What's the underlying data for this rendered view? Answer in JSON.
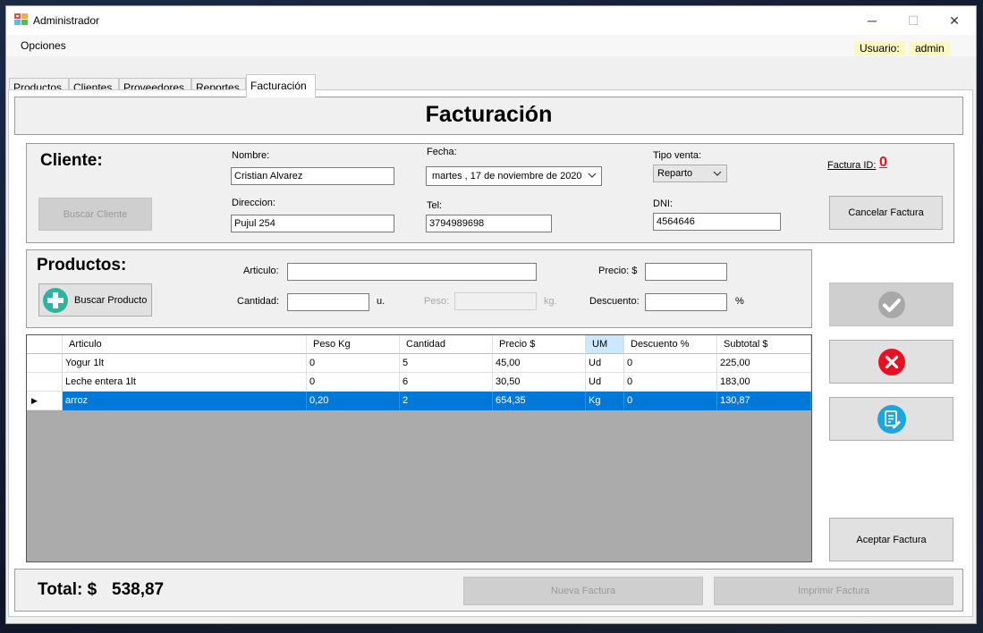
{
  "window": {
    "title": "Administrador",
    "minimize": "─",
    "maximize": "☐",
    "close": "✕"
  },
  "menu": {
    "opciones": "Opciones",
    "usuario_label": "Usuario:",
    "usuario_value": "admin"
  },
  "tabs": [
    {
      "label": "Productos"
    },
    {
      "label": "Clientes"
    },
    {
      "label": "Proveedores"
    },
    {
      "label": "Reportes"
    },
    {
      "label": "Facturación"
    }
  ],
  "header": {
    "title": "Facturación"
  },
  "cliente": {
    "heading": "Cliente:",
    "buscar_cliente": "Buscar Cliente",
    "nombre_label": "Nombre:",
    "nombre_value": "Cristian Alvarez",
    "direccion_label": "Direccion:",
    "direccion_value": "Pujul 254",
    "fecha_label": "Fecha:",
    "fecha_value": "martes   , 17 de noviembre de 2020",
    "tel_label": "Tel:",
    "tel_value": "3794989698",
    "tipo_venta_label": "Tipo venta:",
    "tipo_venta_value": "Reparto",
    "dni_label": "DNI:",
    "dni_value": "4564646",
    "factura_id_label": "Factura ID:",
    "factura_id_value": "0",
    "cancelar_factura": "Cancelar Factura"
  },
  "productos": {
    "heading": "Productos:",
    "buscar_producto": "Buscar Producto",
    "articulo_label": "Articulo:",
    "articulo_value": "",
    "precio_label": "Precio: $",
    "precio_value": "",
    "cantidad_label": "Cantidad:",
    "cantidad_value": "",
    "cantidad_unit": "u.",
    "peso_label": "Peso:",
    "peso_value": "",
    "peso_unit": "kg.",
    "descuento_label": "Descuento:",
    "descuento_value": "",
    "descuento_unit": "%"
  },
  "grid": {
    "columns": [
      "Articulo",
      "Peso Kg",
      "Cantidad",
      "Precio $",
      "UM",
      "Descuento %",
      "Subtotal $"
    ],
    "rows": [
      [
        "Yogur 1lt",
        "0",
        "5",
        "45,00",
        "Ud",
        "0",
        "225,00"
      ],
      [
        "Leche entera 1lt",
        "0",
        "6",
        "30,50",
        "Ud",
        "0",
        "183,00"
      ],
      [
        "arroz",
        "0,20",
        "2",
        "654,35",
        "Kg",
        "0",
        "130,87"
      ]
    ],
    "selected_row": 2,
    "selected_header": 4,
    "row_pointer": "▶"
  },
  "actions": {
    "aceptar_factura": "Aceptar Factura"
  },
  "footer": {
    "total_label": "Total:  $",
    "total_value": "538,87",
    "nueva_factura": "Nueva Factura",
    "imprimir_factura": "Imprimir Factura"
  },
  "colors": {
    "accent": "#0078d7",
    "factura_id": "#e81123",
    "add_icon": "#2db39e",
    "delete_icon": "#e81123",
    "edit_icon": "#1aa6e0"
  },
  "icons": {
    "app": "app-window-icon",
    "add": "plus-circle-icon",
    "confirm": "check-circle-icon",
    "delete": "x-circle-icon",
    "edit": "edit-document-icon"
  }
}
